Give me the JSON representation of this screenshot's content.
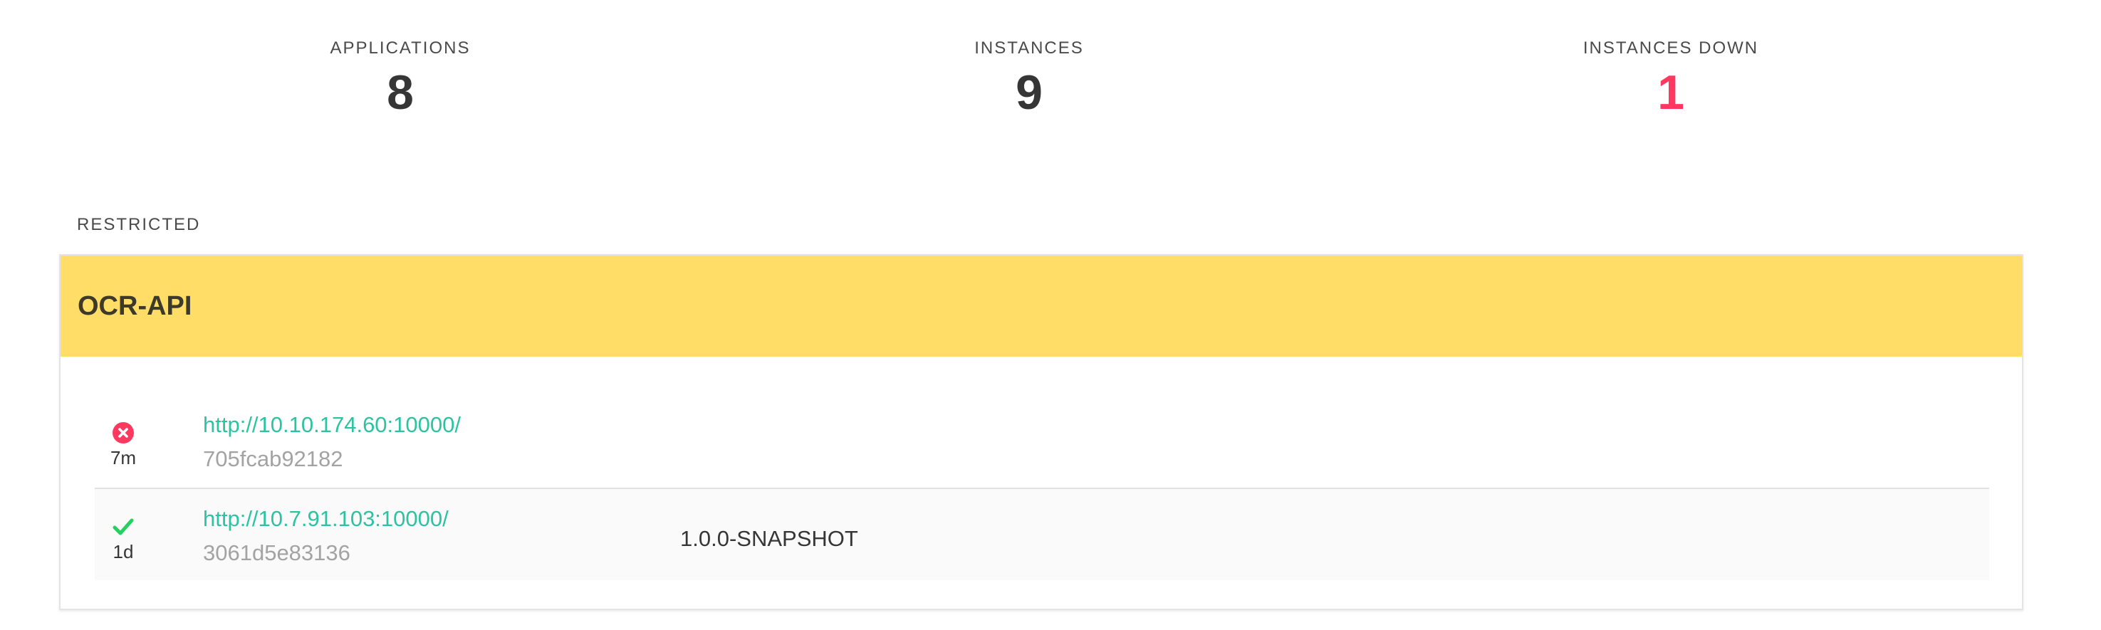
{
  "stats": [
    {
      "label": "APPLICATIONS",
      "value": "8"
    },
    {
      "label": "INSTANCES",
      "value": "9"
    },
    {
      "label": "INSTANCES DOWN",
      "value": "1"
    }
  ],
  "colors": {
    "down": "#ff3860",
    "up": "#23d160",
    "app_header_bg": "#ffdd66",
    "link": "#2cc4a0"
  },
  "group": {
    "label": "RESTRICTED"
  },
  "application": {
    "name": "OCR-API",
    "instances": [
      {
        "status_icon": "error-circle-icon",
        "since": "7m",
        "url": "http://10.10.174.60:10000/",
        "id": "705fcab92182",
        "version": ""
      },
      {
        "status_icon": "check-icon",
        "since": "1d",
        "url": "http://10.7.91.103:10000/",
        "id": "3061d5e83136",
        "version": "1.0.0-SNAPSHOT"
      }
    ]
  }
}
